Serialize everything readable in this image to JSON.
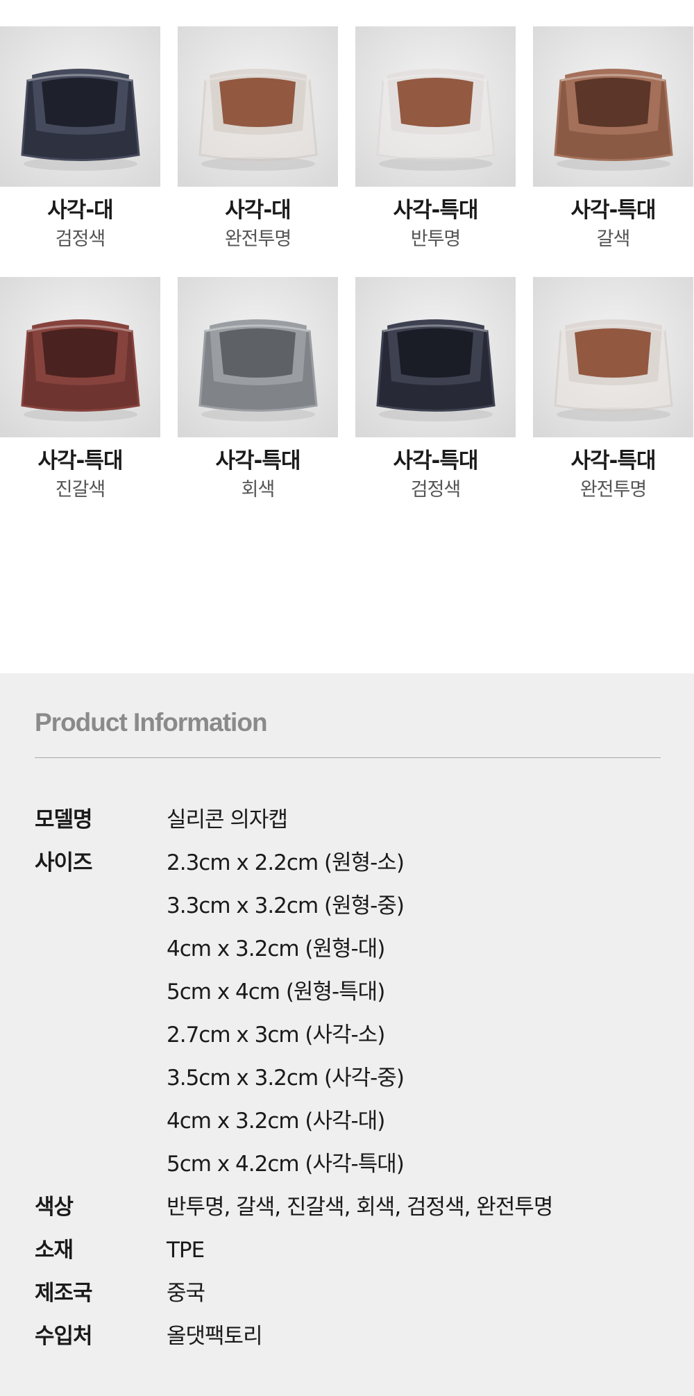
{
  "products": [
    {
      "name": "사각-대",
      "color": "검정색",
      "swatch": "#2d3140",
      "rim": "#454a5c",
      "inner": "#1e212c",
      "translucent": false
    },
    {
      "name": "사각-대",
      "color": "완전투명",
      "swatch": "#e6e0dc",
      "rim": "#cfc6c0",
      "inner": "#8a4a30",
      "translucent": true
    },
    {
      "name": "사각-특대",
      "color": "반투명",
      "swatch": "#ece9e8",
      "rim": "#dcd7d5",
      "inner": "#8a4a30",
      "translucent": true
    },
    {
      "name": "사각-특대",
      "color": "갈색",
      "swatch": "#8a5a44",
      "rim": "#a4705a",
      "inner": "#5c3628",
      "translucent": false
    },
    {
      "name": "사각-특대",
      "color": "진갈색",
      "swatch": "#6e3430",
      "rim": "#86423c",
      "inner": "#4a2220",
      "translucent": false
    },
    {
      "name": "사각-특대",
      "color": "회색",
      "swatch": "#808488",
      "rim": "#9a9ea2",
      "inner": "#5e6266",
      "translucent": false
    },
    {
      "name": "사각-특대",
      "color": "검정색",
      "swatch": "#272a36",
      "rim": "#3d4150",
      "inner": "#1a1c26",
      "translucent": false
    },
    {
      "name": "사각-특대",
      "color": "완전투명",
      "swatch": "#e9e3df",
      "rim": "#d2c9c3",
      "inner": "#8a4a30",
      "translucent": true
    }
  ],
  "info": {
    "title": "Product Information",
    "rows": [
      {
        "label": "모델명",
        "values": [
          "실리콘 의자캡"
        ]
      },
      {
        "label": "사이즈",
        "values": [
          "2.3cm x 2.2cm (원형-소)",
          "3.3cm x 3.2cm (원형-중)",
          "4cm x 3.2cm (원형-대)",
          "5cm x 4cm (원형-특대)",
          "2.7cm x 3cm (사각-소)",
          "3.5cm x 3.2cm (사각-중)",
          "4cm x 3.2cm (사각-대)",
          "5cm x 4.2cm (사각-특대)"
        ]
      },
      {
        "label": "색상",
        "values": [
          "반투명, 갈색, 진갈색, 회색, 검정색, 완전투명"
        ]
      },
      {
        "label": "소재",
        "values": [
          "TPE"
        ]
      },
      {
        "label": "제조국",
        "values": [
          "중국"
        ]
      },
      {
        "label": "수입처",
        "values": [
          "올댓팩토리"
        ]
      }
    ]
  }
}
